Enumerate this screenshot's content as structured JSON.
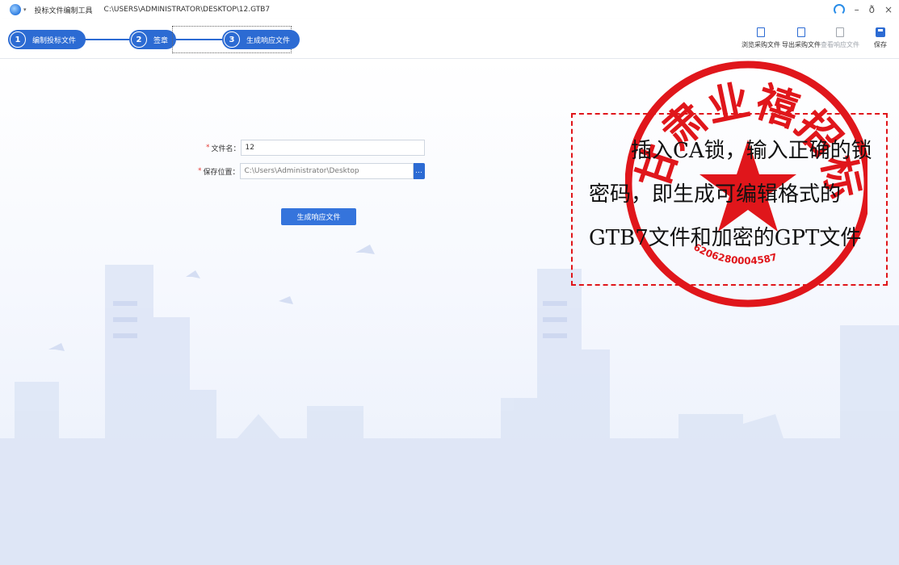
{
  "titlebar": {
    "app_title": "投标文件编制工具",
    "file_path": "C:\\USERS\\ADMINISTRATOR\\DESKTOP\\12.GTB7",
    "minimize": "–",
    "restore": "ð",
    "close": "×"
  },
  "steps": [
    {
      "num": "1",
      "label": "编制投标文件"
    },
    {
      "num": "2",
      "label": "签章"
    },
    {
      "num": "3",
      "label": "生成响应文件"
    }
  ],
  "tools": {
    "browse": "浏览采购文件",
    "export": "导出采购文件",
    "view": "查看响应文件",
    "save": "保存"
  },
  "form": {
    "filename_label": "文件名：",
    "filename_value": "12",
    "location_label": "保存位置：",
    "location_value": "C:\\Users\\Administrator\\Desktop",
    "browse_btn": "...",
    "generate_btn": "生成响应文件"
  },
  "overlay": {
    "annotation_text": "插入CA锁，输入正确的锁密码，即生成可编辑格式的GTB7文件和加密的GPT文件",
    "stamp_text": "甘肃业禧招标有限公司",
    "stamp_number": "6206280004587"
  },
  "colors": {
    "accent": "#2c6bd3",
    "stamp_red": "#e0161b",
    "required": "#e53935"
  }
}
